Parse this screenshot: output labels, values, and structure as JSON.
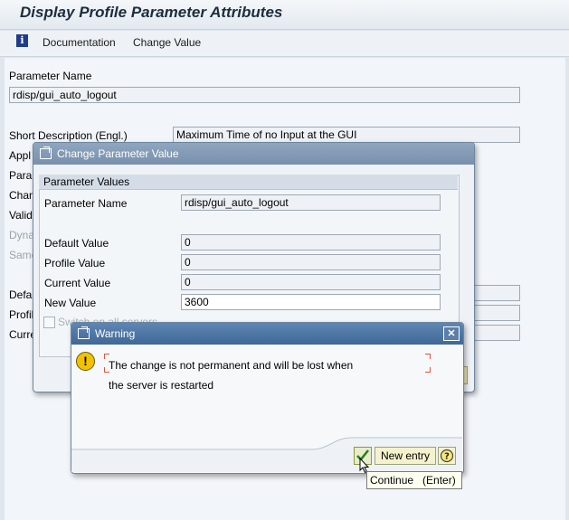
{
  "window": {
    "title": "Display Profile Parameter Attributes"
  },
  "toolbar": {
    "documentation_label": "Documentation",
    "change_value_label": "Change Value"
  },
  "main": {
    "parameter_name_label": "Parameter Name",
    "parameter_name_value": "rdisp/gui_auto_logout",
    "short_description_label": "Short Description (Engl.)",
    "short_description_value": "Maximum Time of no Input at the GUI",
    "partial_labels": [
      "Appl",
      "Para",
      "Chan",
      "Valid",
      "Dyna",
      "Same",
      "Defa",
      "Profil",
      "Curre"
    ]
  },
  "change_dialog": {
    "title": "Change Parameter Value",
    "group_title": "Parameter Values",
    "parameter_name_label": "Parameter Name",
    "parameter_name_value": "rdisp/gui_auto_logout",
    "default_value_label": "Default Value",
    "default_value": "0",
    "profile_value_label": "Profile Value",
    "profile_value": "0",
    "current_value_label": "Current Value",
    "current_value": "0",
    "new_value_label": "New Value",
    "new_value": "3600",
    "switch_label": "Switch on all servers"
  },
  "warning_dialog": {
    "title": "Warning",
    "message_line1": "The change is not permanent and will be lost when",
    "message_line2": "the server is restarted",
    "new_entry_label": "New entry",
    "tooltip": "Continue   (Enter)"
  },
  "icons": {
    "info": "info-icon",
    "dialog": "dialog-window-icon",
    "warning": "warning-icon",
    "close": "close-icon",
    "checkmark": "checkmark-icon",
    "help": "help-icon"
  }
}
